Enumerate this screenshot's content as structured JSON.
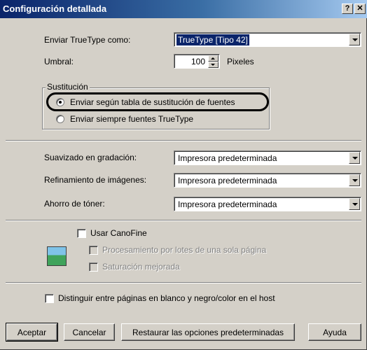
{
  "dialog": {
    "title": "Configuración detallada",
    "help_btn": "?",
    "close_btn": "✕"
  },
  "truetype": {
    "label": "Enviar TrueType como:",
    "value": "TrueType [Tipo 42]"
  },
  "umbral": {
    "label": "Umbral:",
    "value": "100",
    "unit": "Pixeles"
  },
  "sustitucion": {
    "title": "Sustitución",
    "option1": "Enviar según tabla de sustitución de fuentes",
    "option2": "Enviar siempre fuentes TrueType"
  },
  "suavizado": {
    "label": "Suavizado en gradación:",
    "value": "Impresora predeterminada"
  },
  "refinamiento": {
    "label": "Refinamiento de imágenes:",
    "value": "Impresora predeterminada"
  },
  "ahorro": {
    "label": "Ahorro de tóner:",
    "value": "Impresora predeterminada"
  },
  "canofine": {
    "label": "Usar CanoFine",
    "opt1": "Procesamiento por lotes de una sola página",
    "opt2": "Saturación mejorada"
  },
  "distinguir": {
    "label": "Distinguir entre páginas en blanco y negro/color en el host"
  },
  "buttons": {
    "ok": "Aceptar",
    "cancel": "Cancelar",
    "restore": "Restaurar las opciones predeterminadas",
    "help": "Ayuda"
  },
  "colors": {
    "title_bar": "#0a246a",
    "face": "#d4d0c8"
  }
}
